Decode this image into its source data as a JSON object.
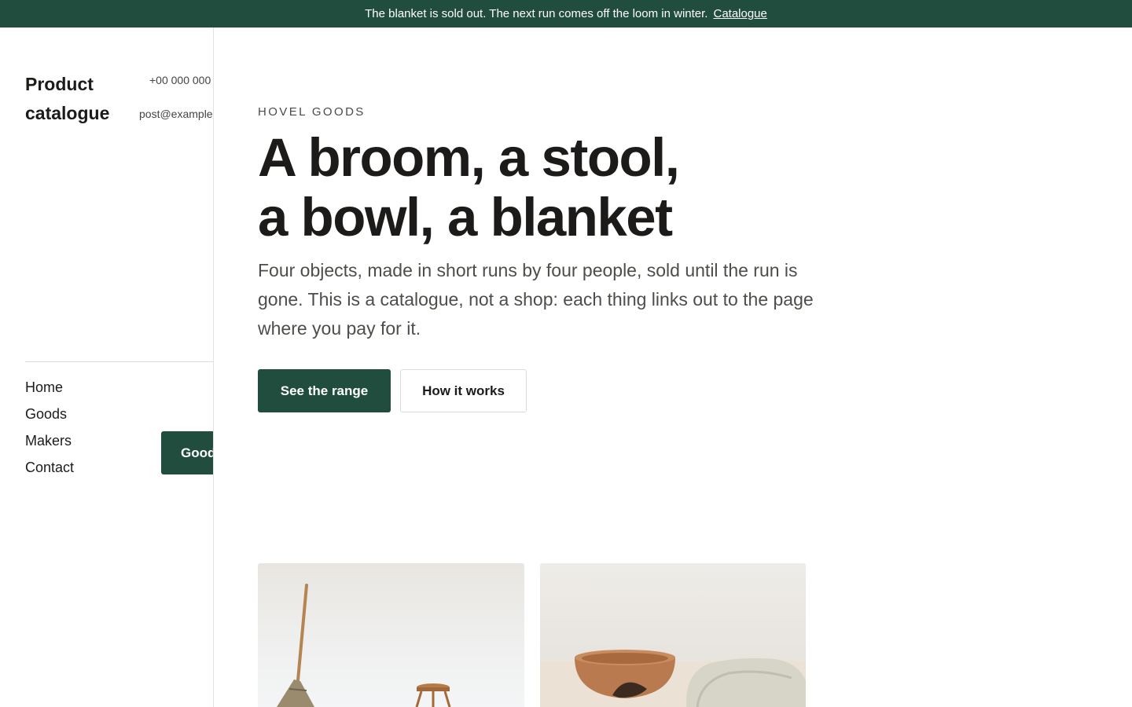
{
  "announcement": {
    "text": "The blanket is sold out. The next run comes off the loom in winter.",
    "link_label": "Catalogue"
  },
  "sidebar": {
    "brand": "Product catalogue",
    "phone": "+00 000 000",
    "email": "post@example",
    "nav": [
      {
        "label": "Home"
      },
      {
        "label": "Goods"
      },
      {
        "label": "Makers"
      },
      {
        "label": "Contact"
      }
    ],
    "cta_label": "Goods"
  },
  "hero": {
    "eyebrow": "HOVEL GOODS",
    "headline_line1": "A broom, a stool,",
    "headline_line2": "a bowl, a blanket",
    "lede": "Four objects, made in short runs by four people, sold until the run is gone. This is a catalogue, not a shop: each thing links out to the page where you pay for it.",
    "primary_button": "See the range",
    "secondary_button": "How it works"
  },
  "colors": {
    "brand_green": "#214d3e",
    "text_dark": "#1c1b19",
    "text_muted": "#4d4d49"
  }
}
